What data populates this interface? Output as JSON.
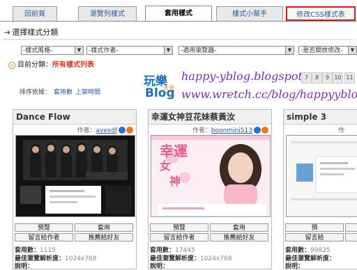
{
  "tabs": [
    {
      "label": "回前頁"
    },
    {
      "label": "瀏覽列樣式"
    },
    {
      "label": "套用樣式"
    },
    {
      "label": "樣式小幫手"
    },
    {
      "label": "修改CSS樣式表"
    }
  ],
  "section_title": "選擇樣式分類",
  "filters": [
    {
      "value": "-樣式風格-"
    },
    {
      "value": "-樣式作者-"
    },
    {
      "value": "-適用瀏覽器-"
    },
    {
      "value": "-是否開放修改-"
    }
  ],
  "category": {
    "label": "目前分類：",
    "value": "所有樣式列表"
  },
  "sort": {
    "label": "排序依據：",
    "option1": "套用數",
    "option2": "上架時間"
  },
  "watermark": {
    "logo_line1": "玩樂",
    "logo_line2": "Blog",
    "logo_small": "大全",
    "line1": "happy-yblog.blogspot.com",
    "line2": "www.wretch.cc/blog/happyyblog"
  },
  "pages": [
    "7",
    "8",
    "9",
    "10",
    "11"
  ],
  "cards": [
    {
      "title": "Dance Flow",
      "author_label": "作者：",
      "author": "avexdf",
      "btn_preview": "預覽",
      "btn_apply": "套用",
      "btn_msg": "留言給作者",
      "btn_share": "推薦給好友",
      "count_label": "套用數：",
      "count": "1115",
      "res_label": "最佳瀏覽解析度：",
      "res": "1024x768",
      "desc_label": "說明："
    },
    {
      "title": "幸運女神豆花妹蔡黃汝",
      "author_label": "作者：",
      "author": "boonmini513",
      "btn_preview": "預覽",
      "btn_apply": "套用",
      "btn_msg": "留言給作者",
      "btn_share": "推薦給好友",
      "count_label": "套用數：",
      "count": "17445",
      "res_label": "最佳瀏覽解析度：",
      "res": "1024x768",
      "desc_label": "說明："
    },
    {
      "title": "simple 3",
      "author_label": "作",
      "author": "",
      "btn_preview": "預",
      "btn_apply": "",
      "btn_msg": "留言給",
      "btn_share": "",
      "count_label": "套用數：",
      "count": "99825",
      "res_label": "最佳瀏覽解析度：",
      "res": "",
      "desc_label": "說明："
    }
  ],
  "shot2": {
    "line1": "幸",
    "line2": "運",
    "line3": "女",
    "line4": "神"
  }
}
